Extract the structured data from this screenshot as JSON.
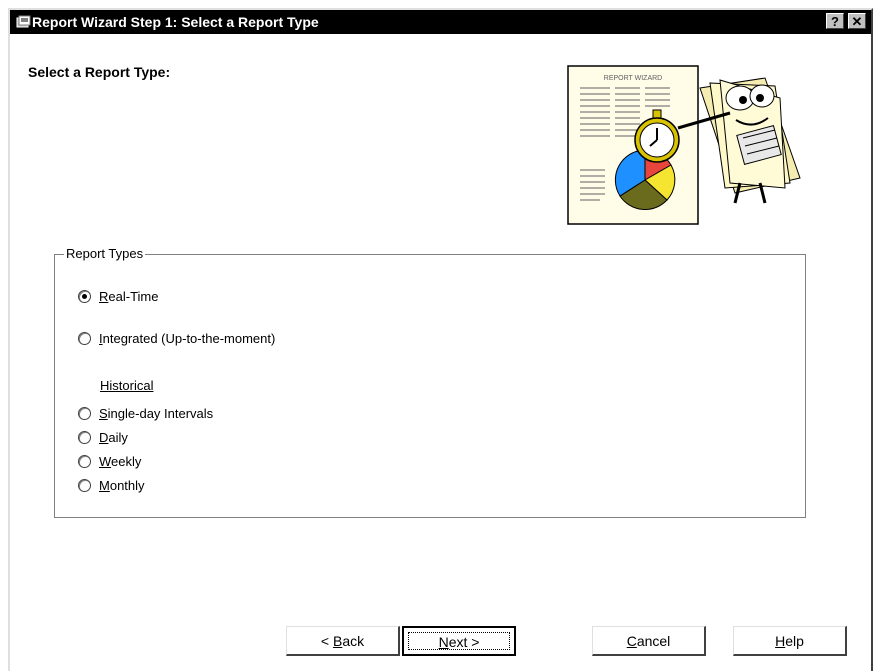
{
  "window": {
    "title": "Report Wizard Step 1: Select a Report Type",
    "help_button": "?",
    "close_button": "✕"
  },
  "main": {
    "heading": "Select a Report Type:",
    "illustration_caption": "REPORT WIZARD"
  },
  "report_types": {
    "legend": "Report Types",
    "options": [
      {
        "mnemonic": "R",
        "rest": "eal-Time",
        "checked": true
      },
      {
        "mnemonic": "I",
        "rest": "ntegrated (Up-to-the-moment)",
        "checked": false
      }
    ],
    "historical_label": "Historical",
    "historical_options": [
      {
        "mnemonic": "S",
        "rest": "ingle-day Intervals",
        "checked": false
      },
      {
        "mnemonic": "D",
        "rest": "aily",
        "checked": false
      },
      {
        "mnemonic": "W",
        "rest": "eekly",
        "checked": false
      },
      {
        "mnemonic": "M",
        "rest": "onthly",
        "checked": false
      }
    ]
  },
  "buttons": {
    "back": {
      "prefix": "< ",
      "mnemonic": "B",
      "rest": "ack"
    },
    "next": {
      "mnemonic": "N",
      "rest": "ext >"
    },
    "cancel": {
      "mnemonic": "C",
      "rest": "ancel"
    },
    "help": {
      "mnemonic": "H",
      "rest": "elp"
    }
  },
  "colors": {
    "titlebar": "#000000",
    "chart_blue": "#1e90ff",
    "chart_red": "#e8463c",
    "chart_yellow": "#f5e430",
    "chart_olive": "#6b6b1e",
    "clock_gold": "#d9c200"
  }
}
